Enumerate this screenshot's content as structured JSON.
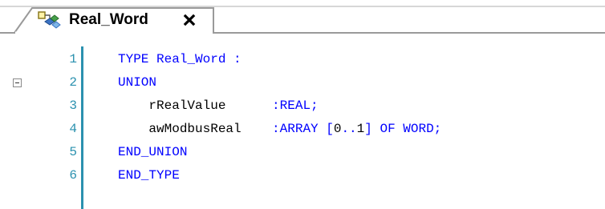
{
  "tab": {
    "title": "Real_Word",
    "icon": "dut-type-icon",
    "close_glyph": "x"
  },
  "editor": {
    "lines": [
      {
        "number": "1",
        "foldable": false,
        "tokens": [
          {
            "text": "TYPE ",
            "kind": "kw"
          },
          {
            "text": "Real_Word :",
            "kind": "kw"
          }
        ]
      },
      {
        "number": "2",
        "foldable": true,
        "tokens": [
          {
            "text": "UNION",
            "kind": "kw"
          }
        ]
      },
      {
        "number": "3",
        "foldable": false,
        "tokens": [
          {
            "text": "    rRealValue",
            "kind": "ident"
          },
          {
            "text": "      :REAL;",
            "kind": "kw"
          }
        ]
      },
      {
        "number": "4",
        "foldable": false,
        "tokens": [
          {
            "text": "    awModbusReal",
            "kind": "ident"
          },
          {
            "text": "    :ARRAY [",
            "kind": "kw"
          },
          {
            "text": "0",
            "kind": "num"
          },
          {
            "text": "..",
            "kind": "kw"
          },
          {
            "text": "1",
            "kind": "num"
          },
          {
            "text": "] OF WORD;",
            "kind": "kw"
          }
        ]
      },
      {
        "number": "5",
        "foldable": false,
        "tokens": [
          {
            "text": "END_UNION",
            "kind": "kw"
          }
        ]
      },
      {
        "number": "6",
        "foldable": false,
        "tokens": [
          {
            "text": "END_TYPE",
            "kind": "kw"
          }
        ]
      }
    ]
  },
  "colors": {
    "keyword": "#0000ff",
    "identifier": "#000000",
    "line_number": "#2b91af",
    "gutter_line": "#2b91af",
    "tab_border": "#9a9a9a"
  }
}
